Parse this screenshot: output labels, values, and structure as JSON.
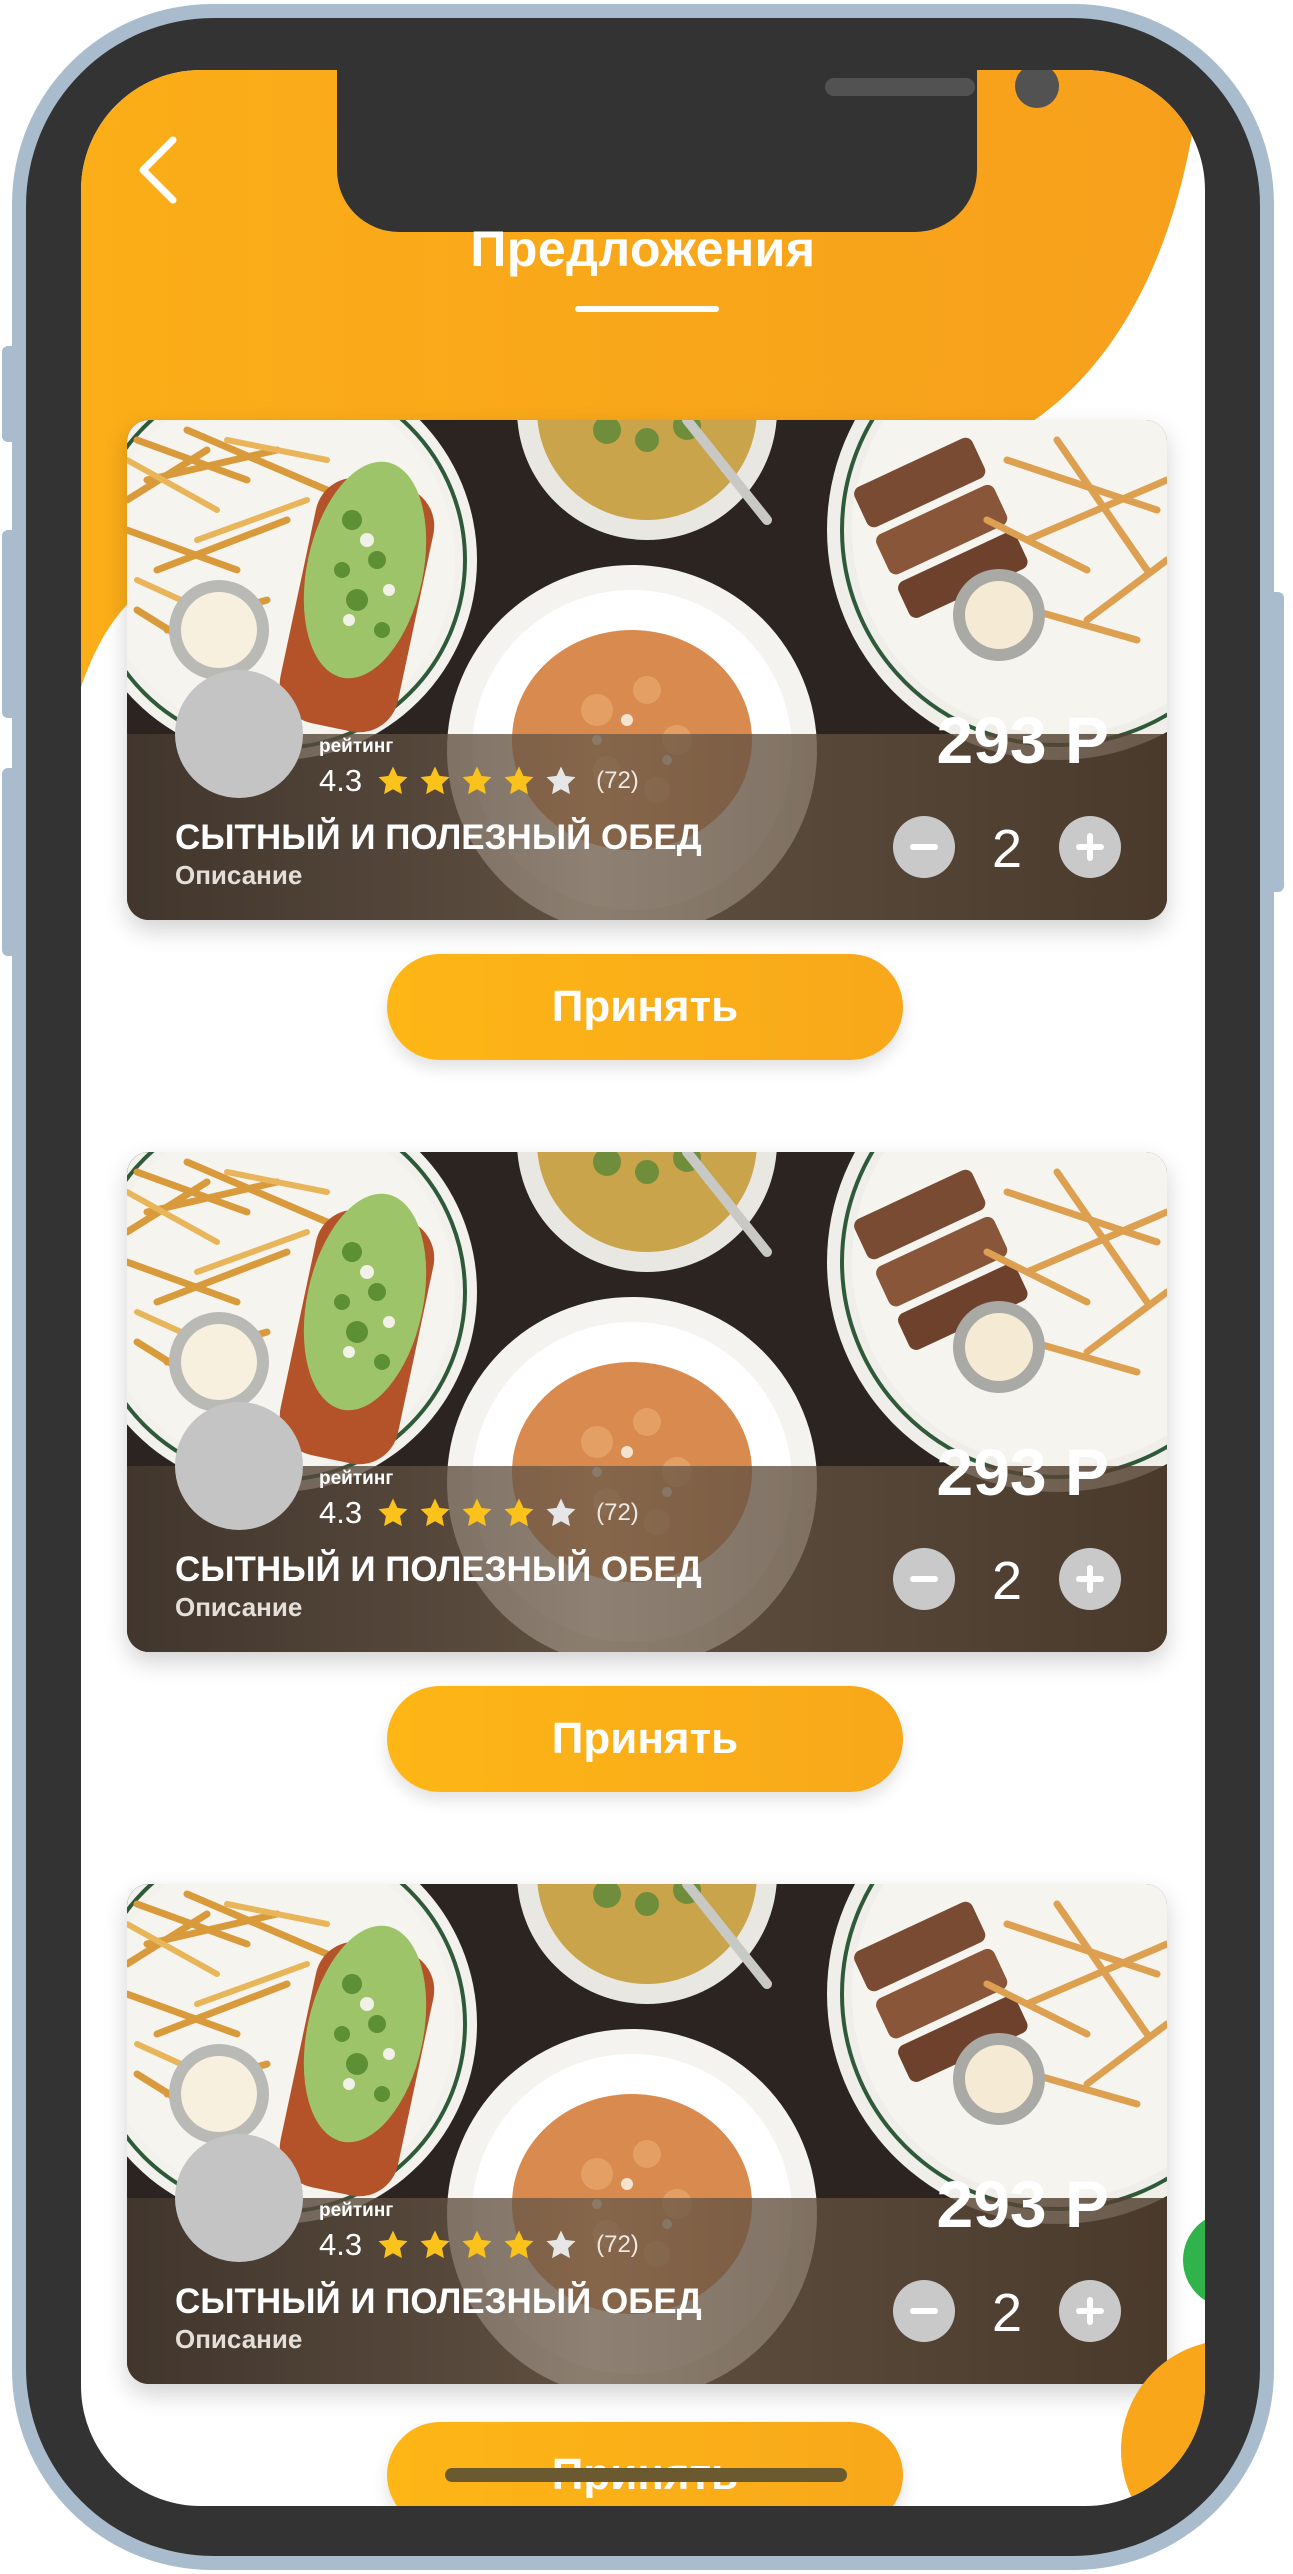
{
  "app": {
    "page_title": "Предложения",
    "back_icon": "chevron-left-icon",
    "accent_color": "#fbac1a",
    "star_color": "#fbc21b"
  },
  "offers": [
    {
      "rating_label": "рейтинг",
      "rating": "4.3",
      "stars_filled": 4,
      "stars_total": 5,
      "reviews": "(72)",
      "name": "СЫТНЫЙ И ПОЛЕЗНЫЙ ОБЕД",
      "description": "Описание",
      "price": "293 Р",
      "quantity": "2",
      "accept_label": "Принять"
    },
    {
      "rating_label": "рейтинг",
      "rating": "4.3",
      "stars_filled": 4,
      "stars_total": 5,
      "reviews": "(72)",
      "name": "СЫТНЫЙ И ПОЛЕЗНЫЙ ОБЕД",
      "description": "Описание",
      "price": "293 Р",
      "quantity": "2",
      "accept_label": "Принять"
    },
    {
      "rating_label": "рейтинг",
      "rating": "4.3",
      "stars_filled": 4,
      "stars_total": 5,
      "reviews": "(72)",
      "name": "СЫТНЫЙ И ПОЛЕЗНЫЙ ОБЕД",
      "description": "Описание",
      "price": "293 Р",
      "quantity": "2",
      "accept_label": "Принять"
    }
  ],
  "last_button": {
    "accept_label": "Принять"
  }
}
